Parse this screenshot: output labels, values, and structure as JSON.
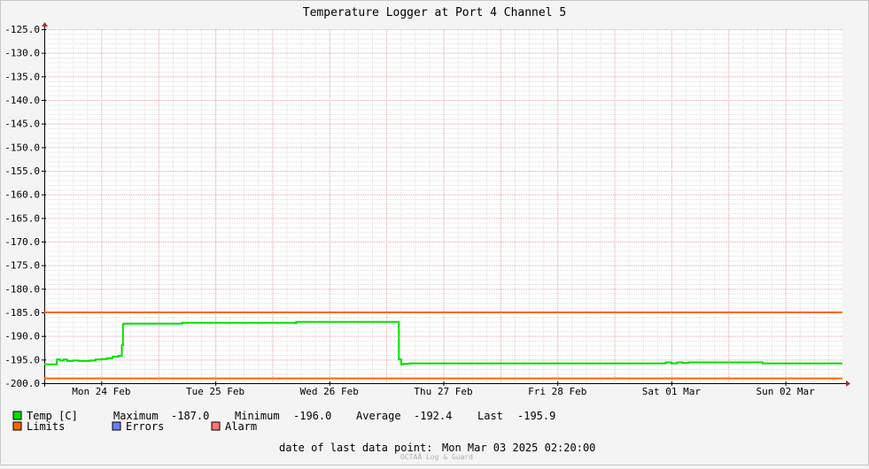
{
  "chart_data": {
    "type": "line",
    "title": "Temperature Logger at Port 4 Channel 5",
    "xlabel": "",
    "ylabel": "",
    "ylim": [
      -200,
      -125
    ],
    "xlim": [
      0,
      7.0
    ],
    "y_ticks": [
      -125.0,
      -130.0,
      -135.0,
      -140.0,
      -145.0,
      -150.0,
      -155.0,
      -160.0,
      -165.0,
      -170.0,
      -175.0,
      -180.0,
      -185.0,
      -190.0,
      -195.0,
      -200.0
    ],
    "y_tick_labels": [
      "-125.0",
      "-130.0",
      "-135.0",
      "-140.0",
      "-145.0",
      "-150.0",
      "-155.0",
      "-160.0",
      "-165.0",
      "-170.0",
      "-175.0",
      "-180.0",
      "-185.0",
      "-190.0",
      "-195.0",
      "-200.0"
    ],
    "x_ticks": [
      0.5,
      1.5,
      2.5,
      3.5,
      4.5,
      5.5,
      6.5
    ],
    "x_tick_labels": [
      "Mon 24 Feb",
      "Tue 25 Feb",
      "Wed 26 Feb",
      "Thu 27 Feb",
      "Fri 28 Feb",
      "Sat 01 Mar",
      "Sun 02 Mar"
    ],
    "grid": true,
    "series": [
      {
        "name": "Temp [C]",
        "color": "#00e000",
        "x": [
          0.0,
          0.1,
          0.11,
          0.14,
          0.17,
          0.2,
          0.25,
          0.3,
          0.35,
          0.4,
          0.45,
          0.5,
          0.55,
          0.6,
          0.65,
          0.68,
          0.69,
          0.7,
          1.1,
          1.2,
          1.21,
          1.5,
          2.0,
          2.2,
          2.21,
          3.1,
          3.11,
          3.13,
          3.15,
          3.2,
          3.5,
          4.0,
          5.0,
          5.4,
          5.45,
          5.5,
          5.55,
          5.6,
          5.65,
          5.7,
          5.8,
          6.0,
          6.2,
          6.3,
          6.4,
          6.5,
          7.0
        ],
        "y": [
          -196.0,
          -196.0,
          -195.0,
          -195.2,
          -195.0,
          -195.3,
          -195.2,
          -195.3,
          -195.3,
          -195.2,
          -195.0,
          -194.9,
          -194.7,
          -194.4,
          -194.2,
          -192.0,
          -187.5,
          -187.4,
          -187.4,
          -187.4,
          -187.2,
          -187.2,
          -187.2,
          -187.3,
          -187.0,
          -187.0,
          -195.0,
          -196.0,
          -195.9,
          -195.8,
          -195.8,
          -195.8,
          -195.8,
          -195.8,
          -195.6,
          -195.8,
          -195.6,
          -195.7,
          -195.6,
          -195.6,
          -195.6,
          -195.6,
          -195.6,
          -195.8,
          -195.8,
          -195.8,
          -195.8
        ]
      },
      {
        "name": "Limits",
        "color": "#ff6600",
        "upper": -185.0,
        "lower": -199.0
      },
      {
        "name": "Errors",
        "color": "#6b7ff5"
      },
      {
        "name": "Alarm",
        "color": "#ff7575"
      }
    ],
    "stats": {
      "maximum_label": "Maximum",
      "maximum": "-187.0",
      "minimum_label": "Minimum",
      "minimum": "-196.0",
      "average_label": "Average",
      "average": "-192.4",
      "last_label": "Last",
      "last": "-195.9"
    },
    "footer": {
      "label": "date of last data point:",
      "value": "Mon Mar 03 2025 02:20:00",
      "watermark": "OCTAÄ Log & Guard"
    }
  }
}
